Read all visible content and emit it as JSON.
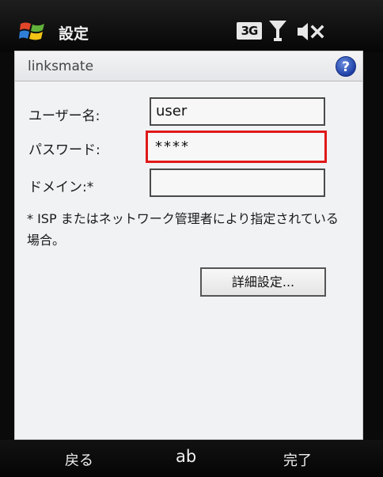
{
  "status_bar": {
    "title": "設定",
    "network_badge": "3G"
  },
  "window": {
    "title": "linksmate",
    "help_label": "?"
  },
  "form": {
    "username": {
      "label": "ユーザー名:",
      "value": "user"
    },
    "password": {
      "label": "パスワード:",
      "value": "****"
    },
    "domain": {
      "label": "ドメイン:*",
      "value": ""
    },
    "note": "* ISP またはネットワーク管理者により指定されている場合。",
    "advanced_button": "詳細設定..."
  },
  "softkeys": {
    "left": "戻る",
    "middle": "ab",
    "right": "完了"
  },
  "colors": {
    "highlight_border": "#e01818",
    "help_icon": "#1d3fa6"
  }
}
